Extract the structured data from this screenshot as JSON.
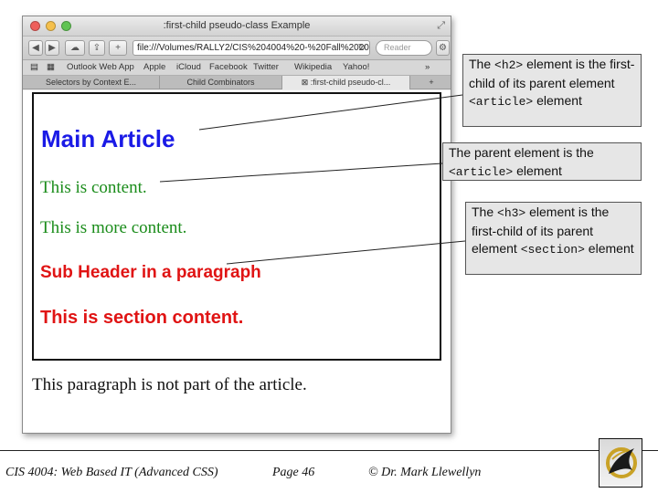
{
  "window": {
    "title": ":first-child pseudo-class Example",
    "url": "file:///Volumes/RALLY2/CIS%204004%20-%20Fall%2020",
    "search_placeholder": "Reader",
    "bookmarks": [
      "Outlook Web App",
      "Apple",
      "iCloud",
      "Facebook",
      "Twitter",
      "Wikipedia",
      "Yahoo!"
    ],
    "tabs": [
      {
        "label": "Selectors by Context E..."
      },
      {
        "label": "Child Combinators"
      },
      {
        "label": ":first-child pseudo-cl..."
      }
    ]
  },
  "page": {
    "h2": "Main Article",
    "p1": "This is content.",
    "p2": "This is more content.",
    "h3": "Sub Header in a paragraph",
    "p3": "This is section content.",
    "p4": "This paragraph is not part of the article."
  },
  "callouts": {
    "c1": {
      "text1": "The ",
      "code1": "<h2>",
      "text2": " element is the first-child of its parent element ",
      "code2": "<article>",
      "text3": " element"
    },
    "c2": {
      "text1": "The parent element is the ",
      "code1": "<article>",
      "text2": " element"
    },
    "c3": {
      "text1": "The ",
      "code1": "<h3>",
      "text2": " element is the first-child of its parent element ",
      "code2": "<section>",
      "text3": " element"
    }
  },
  "footer": {
    "course": "CIS 4004: Web Based IT (Advanced CSS)",
    "page": "Page 46",
    "author": "© Dr. Mark Llewellyn"
  },
  "colors": {
    "h2": "#1a1ae6",
    "content_green": "#1a8c1a",
    "section_red": "#e01414",
    "callout_bg": "#e6e6e6"
  }
}
